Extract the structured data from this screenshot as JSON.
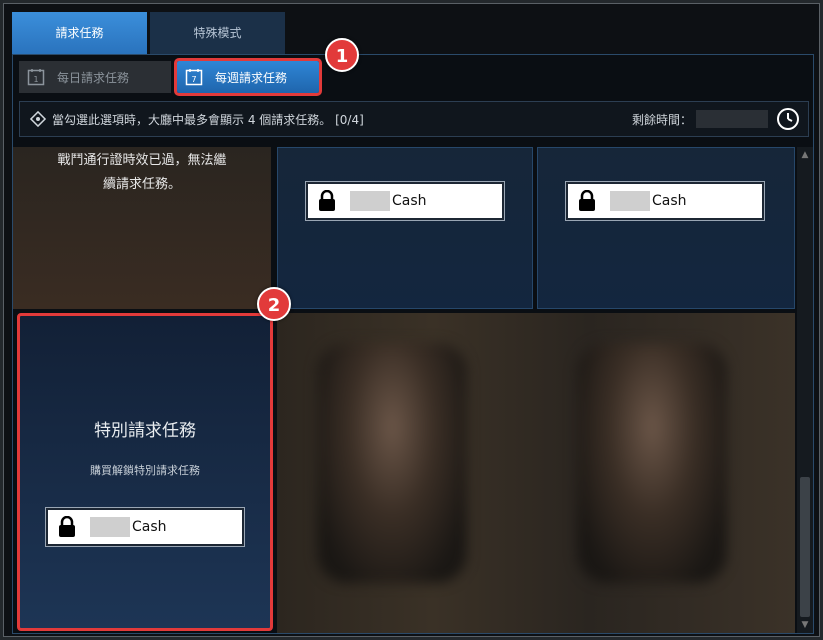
{
  "tabs": [
    "請求任務",
    "特殊模式"
  ],
  "subtabs": [
    {
      "label": "每日請求任務",
      "icon": "calendar-1-icon"
    },
    {
      "label": "每週請求任務",
      "icon": "calendar-7-icon"
    }
  ],
  "infobar": {
    "text": "當勾選此選項時，大廳中最多會顯示 4 個請求任務。 [0/4]",
    "remain_label": "剩餘時間："
  },
  "cards": {
    "expired_line1": "戰鬥通行證時效已過，無法繼",
    "expired_line2": "續請求任務。",
    "cash_label": "Cash",
    "special_title": "特別請求任務",
    "special_sub": "購買解鎖特別請求任務"
  },
  "badges": [
    "1",
    "2"
  ],
  "colors": {
    "accent": "#2f86d6",
    "highlight": "#e23a3a"
  }
}
